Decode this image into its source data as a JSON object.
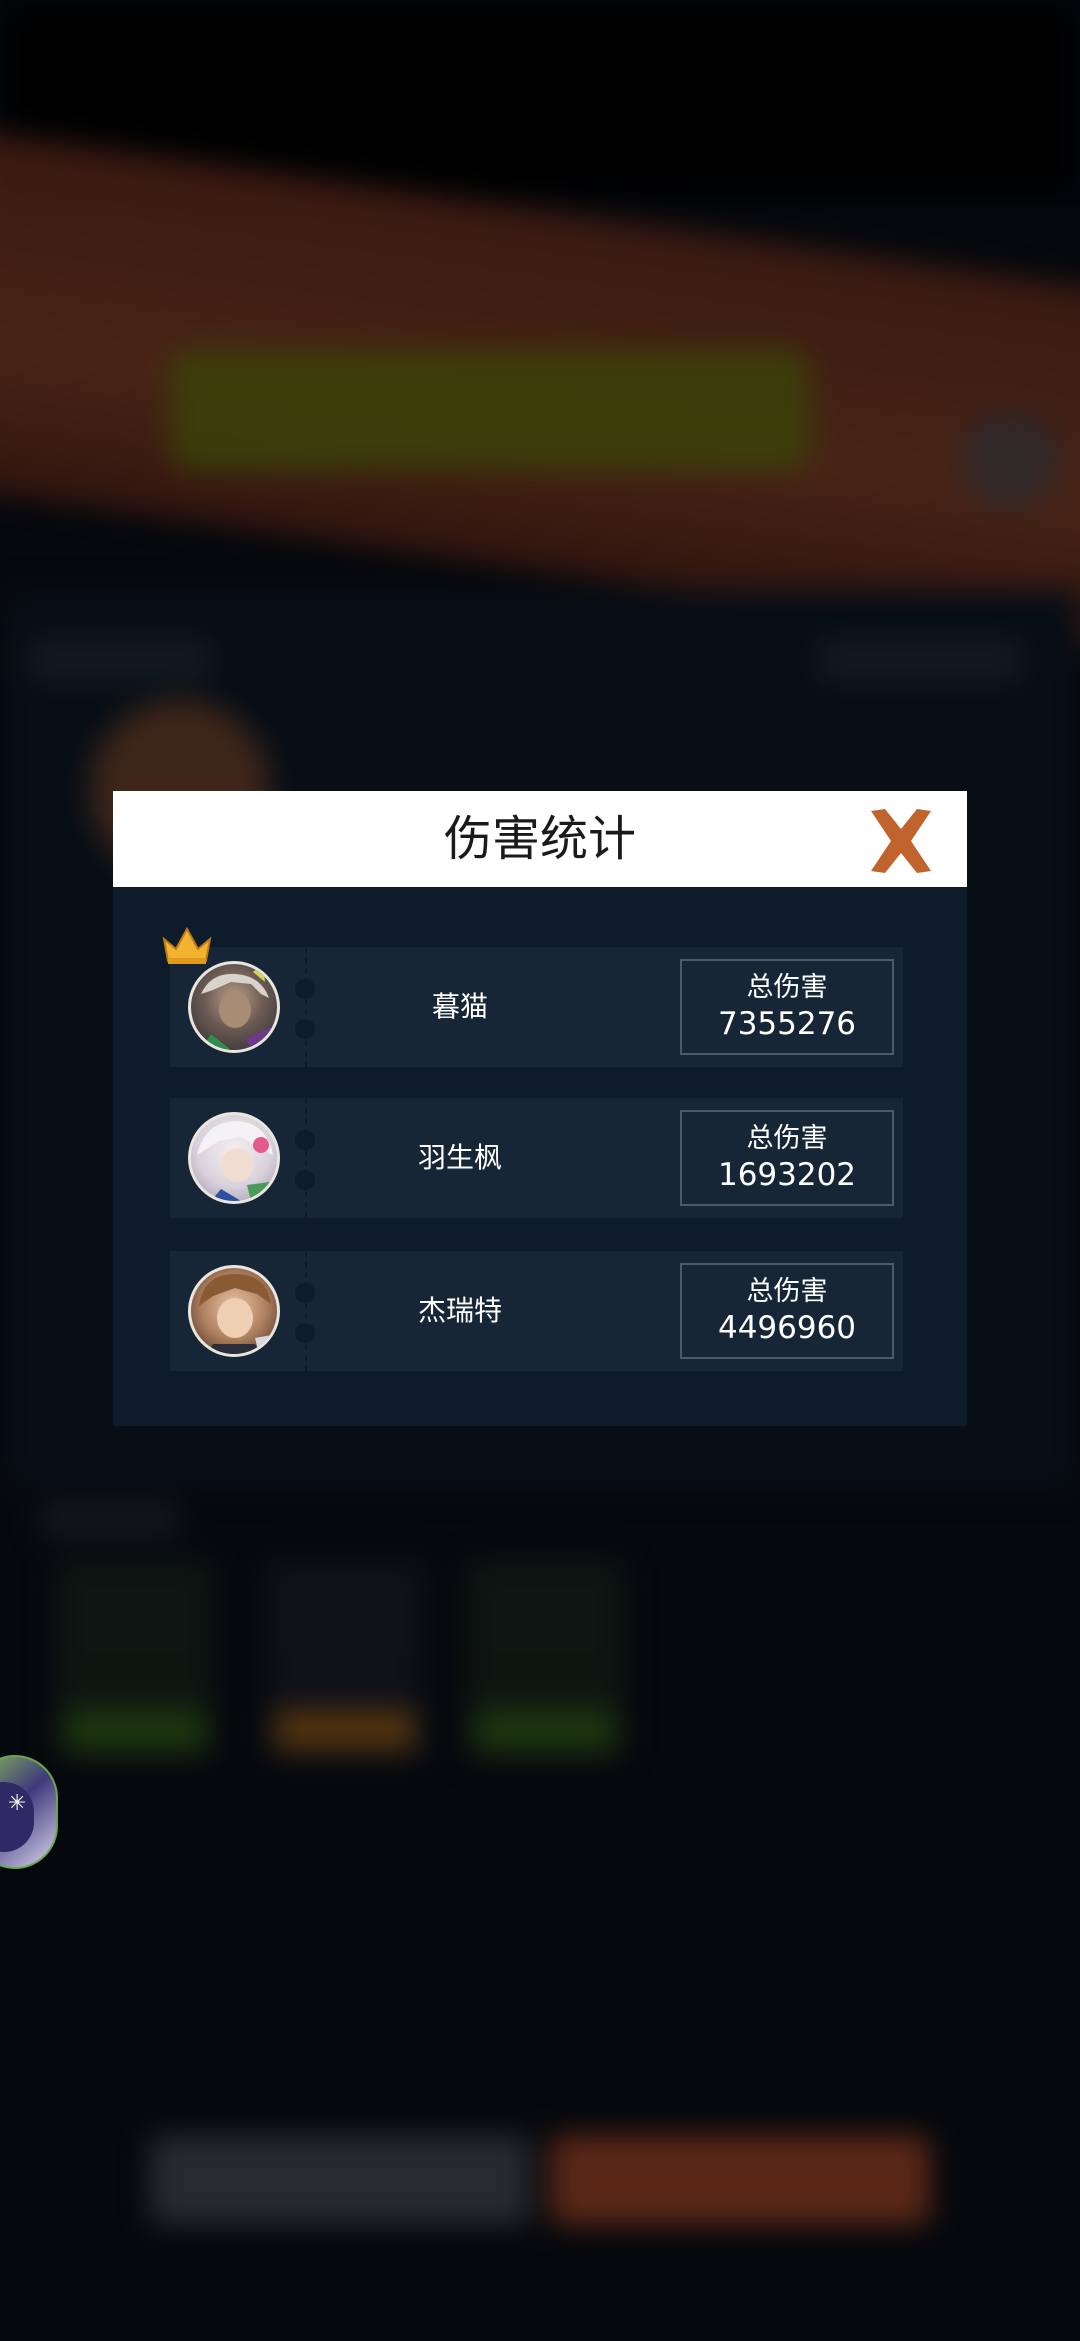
{
  "dialog": {
    "title": "伤害统计",
    "close_icon": "close-x-icon",
    "accent_color": "#c0632c"
  },
  "players": [
    {
      "name": "暮猫",
      "damage_label": "总伤害",
      "damage": "7355276",
      "top_damage": true,
      "avatar": "dark-haired-character-avatar"
    },
    {
      "name": "羽生枫",
      "damage_label": "总伤害",
      "damage": "1693202",
      "top_damage": false,
      "avatar": "white-haired-character-avatar"
    },
    {
      "name": "杰瑞特",
      "damage_label": "总伤害",
      "damage": "4496960",
      "top_damage": false,
      "avatar": "brown-haired-character-avatar"
    }
  ]
}
